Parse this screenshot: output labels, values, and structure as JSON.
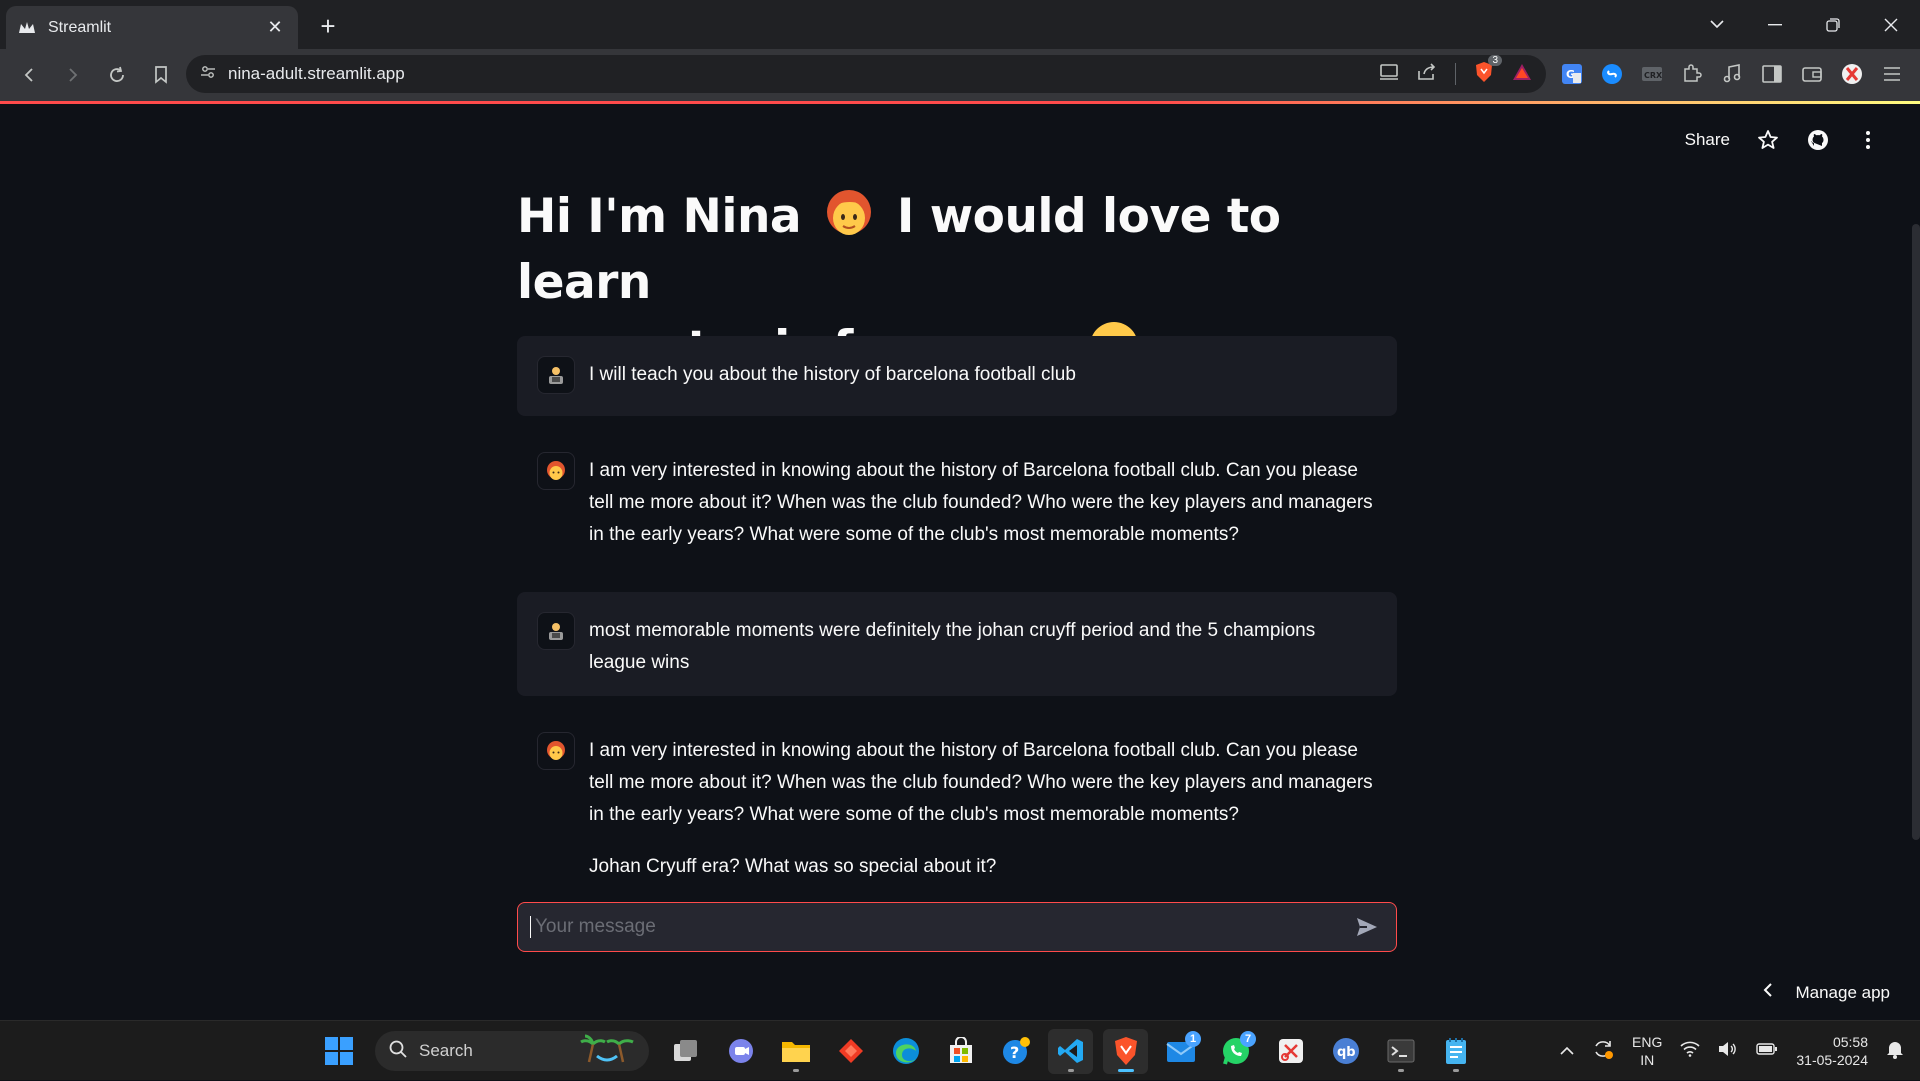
{
  "browser": {
    "tab_title": "Streamlit",
    "url": "nina-adult.streamlit.app",
    "brave_badge": "3"
  },
  "app": {
    "header": {
      "share_label": "Share"
    },
    "title_part1": "Hi I'm Nina",
    "title_part2": "I would love to learn",
    "title_part3": "a new topic from you",
    "messages": [
      {
        "role": "user",
        "text": "I will teach you about the history of barcelona football club"
      },
      {
        "role": "assistant",
        "text": "I am very interested in knowing about the history of Barcelona football club. Can you please tell me more about it? When was the club founded? Who were the key players and managers in the early years? What were some of the club's most memorable moments?"
      },
      {
        "role": "user",
        "text": "most memorable moments were definitely the johan cruyff period and the 5 champions league wins"
      },
      {
        "role": "assistant",
        "text": "I am very interested in knowing about the history of Barcelona football club. Can you please tell me more about it? When was the club founded? Who were the key players and managers in the early years? What were some of the club's most memorable moments?",
        "text2": "Johan Cryuff era? What was so special about it?"
      }
    ],
    "chat_input": {
      "placeholder": "Your message"
    },
    "manage_app_label": "Manage app"
  },
  "taskbar": {
    "search_label": "Search",
    "mail_badge": "1",
    "whatsapp_badge": "7",
    "lang_line1": "ENG",
    "lang_line2": "IN",
    "time": "05:58",
    "date": "31-05-2024"
  },
  "colors": {
    "accent": "#ff4b4b",
    "background": "#0e1117",
    "user_message_bg": "#1a1c24"
  }
}
